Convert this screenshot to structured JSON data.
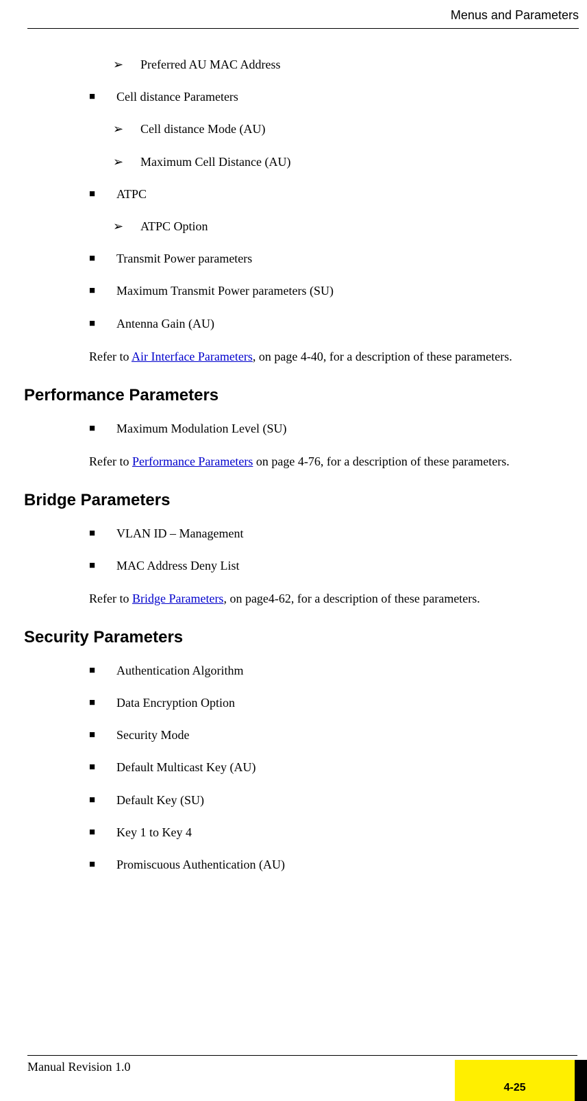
{
  "header": {
    "title": "Menus and Parameters"
  },
  "top_sublist": [
    "Preferred AU MAC Address"
  ],
  "top_items": [
    {
      "label": "Cell distance Parameters",
      "sub": [
        "Cell distance Mode (AU)",
        "Maximum Cell Distance (AU)"
      ]
    },
    {
      "label": "ATPC",
      "sub": [
        "ATPC Option"
      ]
    },
    {
      "label": "Transmit Power parameters"
    },
    {
      "label": "Maximum Transmit Power parameters (SU)"
    },
    {
      "label": "Antenna Gain (AU)"
    }
  ],
  "para1": {
    "pre": "Refer to ",
    "link": "Air Interface Parameters",
    "post": ", on page 4-40, for a description of these parameters."
  },
  "sections": {
    "performance": {
      "heading": "Performance Parameters",
      "items": [
        "Maximum Modulation Level (SU)"
      ],
      "para": {
        "pre": "Refer to ",
        "link": "Performance Parameters",
        "post": " on page 4-76, for a description of these parameters."
      }
    },
    "bridge": {
      "heading": "Bridge Parameters",
      "items": [
        "VLAN ID – Management",
        "MAC Address Deny List"
      ],
      "para": {
        "pre": "Refer to ",
        "link": "Bridge Parameters",
        "post": ", on page4-62, for a description of these parameters."
      }
    },
    "security": {
      "heading": "Security Parameters",
      "items": [
        "Authentication Algorithm",
        "Data Encryption Option",
        "Security Mode",
        "Default Multicast Key (AU)",
        "Default Key (SU)",
        "Key 1 to Key 4",
        "Promiscuous Authentication (AU)"
      ]
    }
  },
  "footer": {
    "left": "Manual Revision 1.0",
    "page": "4-25"
  }
}
